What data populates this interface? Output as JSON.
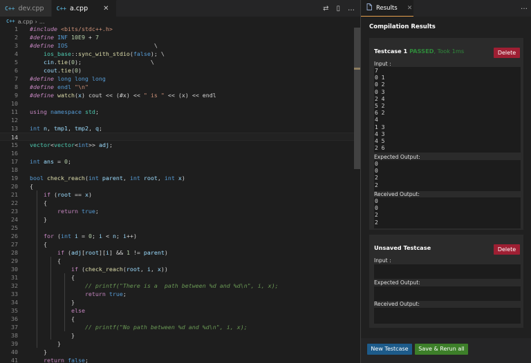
{
  "editor": {
    "tabs": [
      {
        "icon": "C++",
        "label": "dev.cpp",
        "active": false
      },
      {
        "icon": "C++",
        "label": "a.cpp",
        "active": true,
        "close": "✕"
      }
    ],
    "actions": [
      "⇄",
      "▯",
      "…"
    ],
    "breadcrumb": {
      "icon": "C++",
      "file": "a.cpp",
      "sep": "›",
      "more": "..."
    },
    "lines": [
      {
        "n": "1",
        "tokens": [
          [
            "pp",
            "#include "
          ],
          [
            "str",
            "<bits/stdc++.h>"
          ]
        ]
      },
      {
        "n": "2",
        "tokens": [
          [
            "pp",
            "#define "
          ],
          [
            "def",
            "INF "
          ],
          [
            "num",
            "10E9"
          ],
          [
            "plain",
            " + "
          ],
          [
            "num",
            "7"
          ]
        ]
      },
      {
        "n": "3",
        "tokens": [
          [
            "pp",
            "#define "
          ],
          [
            "def",
            "IOS"
          ],
          [
            "plain",
            "                         \\"
          ]
        ]
      },
      {
        "n": "4",
        "tokens": [
          [
            "plain",
            "    "
          ],
          [
            "ty",
            "ios_base"
          ],
          [
            "plain",
            "::"
          ],
          [
            "fn",
            "sync_with_stdio"
          ],
          [
            "plain",
            "("
          ],
          [
            "kw",
            "false"
          ],
          [
            "plain",
            "); \\"
          ]
        ]
      },
      {
        "n": "5",
        "tokens": [
          [
            "plain",
            "    "
          ],
          [
            "var",
            "cin"
          ],
          [
            "plain",
            "."
          ],
          [
            "fn",
            "tie"
          ],
          [
            "plain",
            "("
          ],
          [
            "num",
            "0"
          ],
          [
            "plain",
            ");                    \\"
          ]
        ]
      },
      {
        "n": "6",
        "tokens": [
          [
            "plain",
            "    "
          ],
          [
            "var",
            "cout"
          ],
          [
            "plain",
            "."
          ],
          [
            "fn",
            "tie"
          ],
          [
            "plain",
            "("
          ],
          [
            "num",
            "0"
          ],
          [
            "plain",
            ")"
          ]
        ]
      },
      {
        "n": "7",
        "tokens": [
          [
            "pp",
            "#define "
          ],
          [
            "def",
            "long long long"
          ]
        ]
      },
      {
        "n": "8",
        "tokens": [
          [
            "pp",
            "#define "
          ],
          [
            "def",
            "endl "
          ],
          [
            "str",
            "\"\\n\""
          ]
        ]
      },
      {
        "n": "9",
        "tokens": [
          [
            "pp",
            "#define "
          ],
          [
            "fn",
            "watch"
          ],
          [
            "plain",
            "("
          ],
          [
            "var",
            "x"
          ],
          [
            "plain",
            ") cout << (#x) << "
          ],
          [
            "str",
            "\" is \""
          ],
          [
            "plain",
            " << (x) << endl"
          ]
        ]
      },
      {
        "n": "10",
        "tokens": []
      },
      {
        "n": "11",
        "tokens": [
          [
            "k",
            "using "
          ],
          [
            "kw",
            "namespace "
          ],
          [
            "ty",
            "std"
          ],
          [
            "plain",
            ";"
          ]
        ]
      },
      {
        "n": "12",
        "tokens": []
      },
      {
        "n": "13",
        "tokens": [
          [
            "kw",
            "int "
          ],
          [
            "var",
            "n"
          ],
          [
            "plain",
            ", "
          ],
          [
            "var",
            "tmp1"
          ],
          [
            "plain",
            ", "
          ],
          [
            "var",
            "tmp2"
          ],
          [
            "plain",
            ", "
          ],
          [
            "var",
            "q"
          ],
          [
            "plain",
            ";"
          ]
        ]
      },
      {
        "n": "14",
        "tokens": [],
        "current": true
      },
      {
        "n": "15",
        "tokens": [
          [
            "ty",
            "vector"
          ],
          [
            "plain",
            "<"
          ],
          [
            "ty",
            "vector"
          ],
          [
            "plain",
            "<"
          ],
          [
            "kw",
            "int"
          ],
          [
            "plain",
            ">> "
          ],
          [
            "var",
            "adj"
          ],
          [
            "plain",
            ";"
          ]
        ]
      },
      {
        "n": "16",
        "tokens": []
      },
      {
        "n": "17",
        "tokens": [
          [
            "kw",
            "int "
          ],
          [
            "var",
            "ans"
          ],
          [
            "plain",
            " = "
          ],
          [
            "num",
            "0"
          ],
          [
            "plain",
            ";"
          ]
        ]
      },
      {
        "n": "18",
        "tokens": []
      },
      {
        "n": "19",
        "tokens": [
          [
            "kw",
            "bool "
          ],
          [
            "fn",
            "check_reach"
          ],
          [
            "plain",
            "("
          ],
          [
            "kw",
            "int "
          ],
          [
            "var",
            "parent"
          ],
          [
            "plain",
            ", "
          ],
          [
            "kw",
            "int "
          ],
          [
            "var",
            "root"
          ],
          [
            "plain",
            ", "
          ],
          [
            "kw",
            "int "
          ],
          [
            "var",
            "x"
          ],
          [
            "plain",
            ")"
          ]
        ]
      },
      {
        "n": "20",
        "tokens": [
          [
            "plain",
            "{"
          ]
        ]
      },
      {
        "n": "21",
        "tokens": [
          [
            "plain",
            "    "
          ],
          [
            "k",
            "if "
          ],
          [
            "plain",
            "("
          ],
          [
            "var",
            "root"
          ],
          [
            "plain",
            " == "
          ],
          [
            "var",
            "x"
          ],
          [
            "plain",
            ")"
          ]
        ]
      },
      {
        "n": "22",
        "tokens": [
          [
            "plain",
            "    {"
          ]
        ]
      },
      {
        "n": "23",
        "tokens": [
          [
            "plain",
            "        "
          ],
          [
            "k",
            "return "
          ],
          [
            "kw",
            "true"
          ],
          [
            "plain",
            ";"
          ]
        ]
      },
      {
        "n": "24",
        "tokens": [
          [
            "plain",
            "    }"
          ]
        ]
      },
      {
        "n": "25",
        "tokens": []
      },
      {
        "n": "26",
        "tokens": [
          [
            "plain",
            "    "
          ],
          [
            "k",
            "for "
          ],
          [
            "plain",
            "("
          ],
          [
            "kw",
            "int "
          ],
          [
            "var",
            "i"
          ],
          [
            "plain",
            " = "
          ],
          [
            "num",
            "0"
          ],
          [
            "plain",
            "; "
          ],
          [
            "var",
            "i"
          ],
          [
            "plain",
            " < "
          ],
          [
            "var",
            "n"
          ],
          [
            "plain",
            "; "
          ],
          [
            "var",
            "i"
          ],
          [
            "plain",
            "++)"
          ]
        ]
      },
      {
        "n": "27",
        "tokens": [
          [
            "plain",
            "    {"
          ]
        ]
      },
      {
        "n": "28",
        "tokens": [
          [
            "plain",
            "        "
          ],
          [
            "k",
            "if "
          ],
          [
            "plain",
            "("
          ],
          [
            "var",
            "adj"
          ],
          [
            "plain",
            "["
          ],
          [
            "var",
            "root"
          ],
          [
            "plain",
            "]["
          ],
          [
            "var",
            "i"
          ],
          [
            "plain",
            "] && "
          ],
          [
            "num",
            "1"
          ],
          [
            "plain",
            " != "
          ],
          [
            "var",
            "parent"
          ],
          [
            "plain",
            ")"
          ]
        ]
      },
      {
        "n": "29",
        "tokens": [
          [
            "plain",
            "        {"
          ]
        ]
      },
      {
        "n": "30",
        "tokens": [
          [
            "plain",
            "            "
          ],
          [
            "k",
            "if "
          ],
          [
            "plain",
            "("
          ],
          [
            "fn",
            "check_reach"
          ],
          [
            "plain",
            "("
          ],
          [
            "var",
            "root"
          ],
          [
            "plain",
            ", "
          ],
          [
            "var",
            "i"
          ],
          [
            "plain",
            ", "
          ],
          [
            "var",
            "x"
          ],
          [
            "plain",
            "))"
          ]
        ]
      },
      {
        "n": "31",
        "tokens": [
          [
            "plain",
            "            {"
          ]
        ]
      },
      {
        "n": "32",
        "tokens": [
          [
            "plain",
            "                "
          ],
          [
            "com",
            "// printf(\"There is a  path between %d and %d\\n\", i, x);"
          ]
        ]
      },
      {
        "n": "33",
        "tokens": [
          [
            "plain",
            "                "
          ],
          [
            "k",
            "return "
          ],
          [
            "kw",
            "true"
          ],
          [
            "plain",
            ";"
          ]
        ]
      },
      {
        "n": "34",
        "tokens": [
          [
            "plain",
            "            }"
          ]
        ]
      },
      {
        "n": "35",
        "tokens": [
          [
            "plain",
            "            "
          ],
          [
            "k",
            "else"
          ]
        ]
      },
      {
        "n": "36",
        "tokens": [
          [
            "plain",
            "            {"
          ]
        ]
      },
      {
        "n": "37",
        "tokens": [
          [
            "plain",
            "                "
          ],
          [
            "com",
            "// printf(\"No path between %d and %d\\n\", i, x);"
          ]
        ]
      },
      {
        "n": "38",
        "tokens": [
          [
            "plain",
            "            }"
          ]
        ]
      },
      {
        "n": "39",
        "tokens": [
          [
            "plain",
            "        }"
          ]
        ]
      },
      {
        "n": "40",
        "tokens": [
          [
            "plain",
            "    }"
          ]
        ]
      },
      {
        "n": "41",
        "tokens": [
          [
            "plain",
            "    "
          ],
          [
            "k",
            "return "
          ],
          [
            "kw",
            "false"
          ],
          [
            "plain",
            ";"
          ]
        ]
      }
    ]
  },
  "results": {
    "tab_label": "Results",
    "tab_close": "✕",
    "more": "…",
    "title": "Compilation Results",
    "testcase1": {
      "title": "Testcase 1",
      "status": "PASSED",
      "took": ", Took 1ms",
      "delete": "Delete",
      "input_label": "Input :",
      "input": "7\n0 1\n0 2\n0 3\n2 4\n5 2\n6 2\n4\n1 3\n4 3\n4 5\n2 6",
      "expected_label": "Expected Output:",
      "expected": "0\n0\n2\n2",
      "received_label": "Received Output:",
      "received": "0\n0\n2\n2"
    },
    "unsaved": {
      "title": "Unsaved Testcase",
      "delete": "Delete",
      "input_label": "Input :",
      "expected_label": "Expected Output:",
      "received_label": "Received Output:"
    },
    "new_testcase": "New Testcase",
    "save_rerun": "Save & Rerun all"
  }
}
